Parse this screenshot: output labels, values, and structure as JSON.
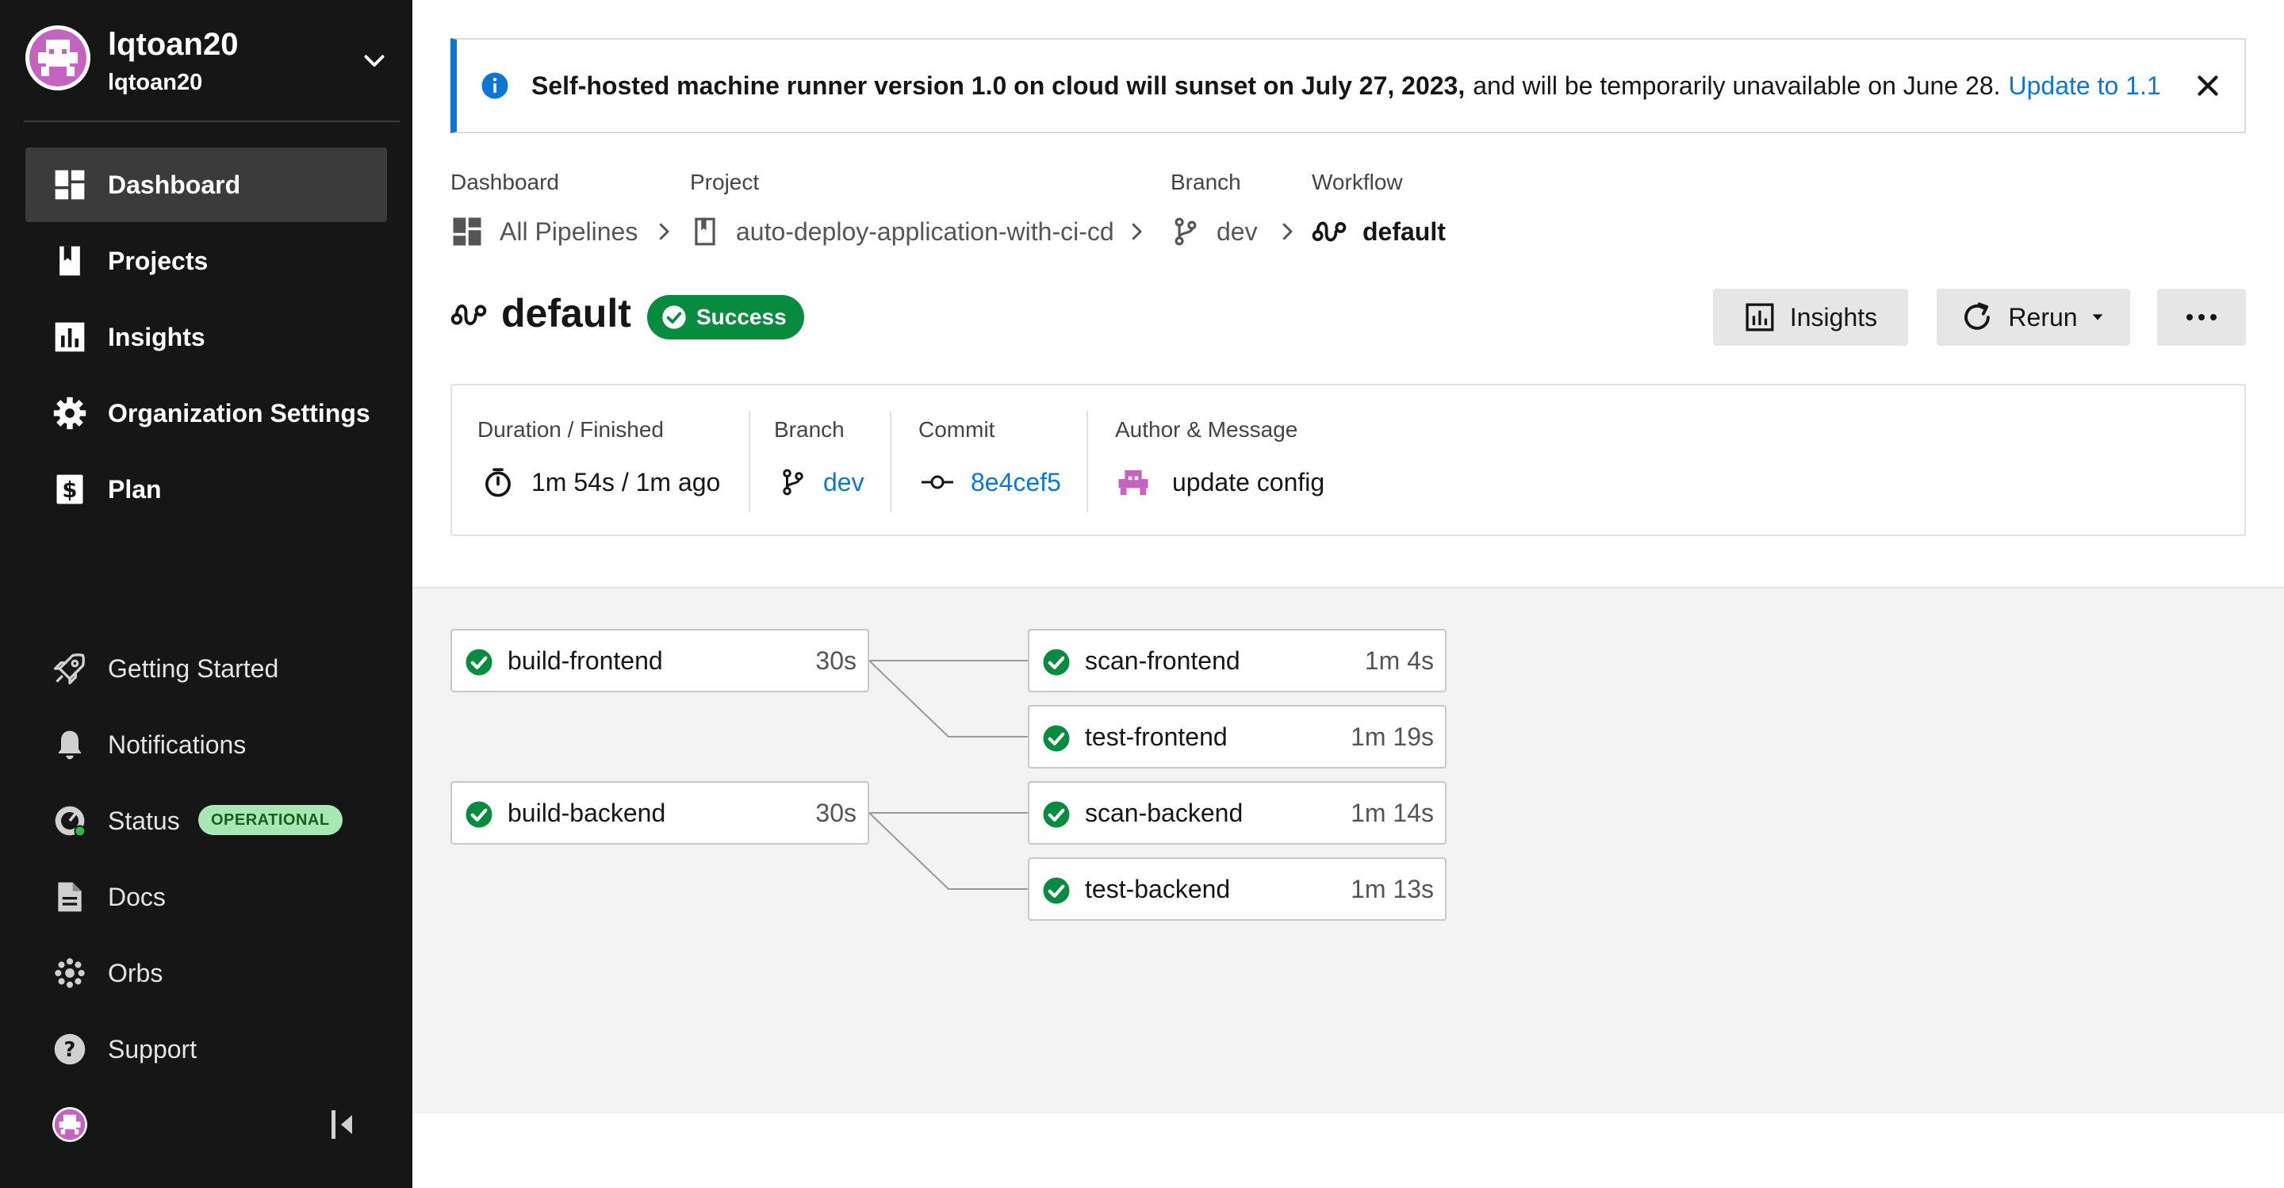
{
  "user": {
    "name": "lqtoan20",
    "handle": "lqtoan20"
  },
  "nav": {
    "dashboard": "Dashboard",
    "projects": "Projects",
    "insights": "Insights",
    "org_settings": "Organization Settings",
    "plan": "Plan",
    "getting_started": "Getting Started",
    "notifications": "Notifications",
    "status": "Status",
    "status_badge": "OPERATIONAL",
    "docs": "Docs",
    "orbs": "Orbs",
    "support": "Support"
  },
  "banner": {
    "bold_text": "Self-hosted machine runner version 1.0 on cloud will sunset on July 27, 2023,",
    "text": "and will be temporarily unavailable on June 28.",
    "link": "Update to 1.1"
  },
  "breadcrumb": {
    "dashboard_label": "Dashboard",
    "dashboard_value": "All Pipelines",
    "project_label": "Project",
    "project_value": "auto-deploy-application-with-ci-cd",
    "branch_label": "Branch",
    "branch_value": "dev",
    "workflow_label": "Workflow",
    "workflow_value": "default"
  },
  "workflow": {
    "title": "default",
    "status": "Success",
    "insights_button": "Insights",
    "rerun_button": "Rerun"
  },
  "details": {
    "duration_label": "Duration / Finished",
    "duration_value": "1m 54s / 1m ago",
    "branch_label": "Branch",
    "branch_value": "dev",
    "commit_label": "Commit",
    "commit_value": "8e4cef5",
    "author_label": "Author & Message",
    "message": "update config"
  },
  "jobs": [
    {
      "name": "build-frontend",
      "duration": "30s",
      "status": "success"
    },
    {
      "name": "scan-frontend",
      "duration": "1m 4s",
      "status": "success"
    },
    {
      "name": "test-frontend",
      "duration": "1m 19s",
      "status": "success"
    },
    {
      "name": "build-backend",
      "duration": "30s",
      "status": "success"
    },
    {
      "name": "scan-backend",
      "duration": "1m 14s",
      "status": "success"
    },
    {
      "name": "test-backend",
      "duration": "1m 13s",
      "status": "success"
    }
  ],
  "colors": {
    "sidebar_bg": "#161616",
    "accent_blue": "#0c77d3",
    "success_green": "#078b3f",
    "avatar_pink": "#c564c0"
  }
}
